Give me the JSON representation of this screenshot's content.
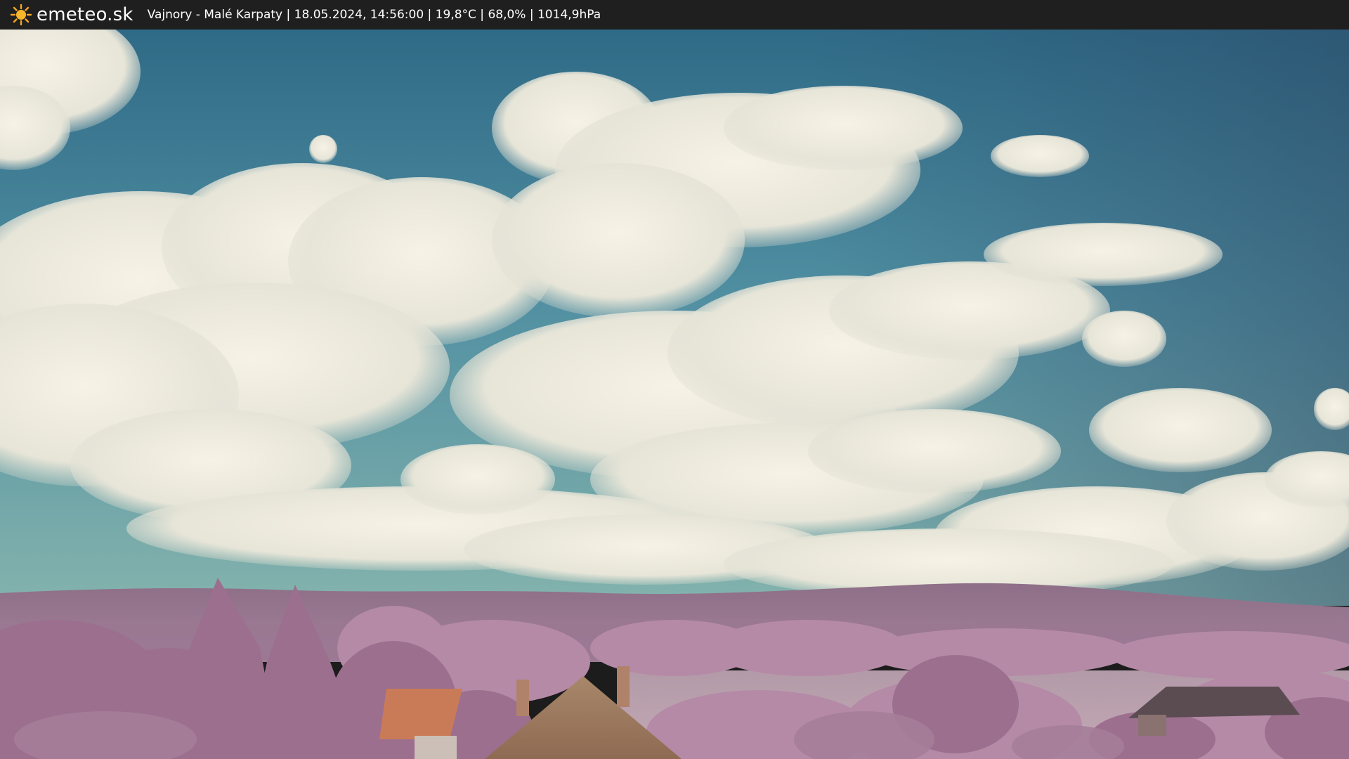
{
  "header": {
    "brand": "emeteo.sk",
    "logo_icon": "sun-icon",
    "caption": "Vajnory - Malé Karpaty | 18.05.2024, 14:56:00 | 19,8°C | 68,0% | 1014,9hPa"
  },
  "image": {
    "subject": "webcam-view",
    "colors": {
      "sky_top": "#2f6a86",
      "sky_bottom": "#6fa7a9",
      "cloud": "#efece0",
      "hills": "#8c6e86",
      "foliage": "#b98bab",
      "roof": "#c97b58"
    }
  }
}
